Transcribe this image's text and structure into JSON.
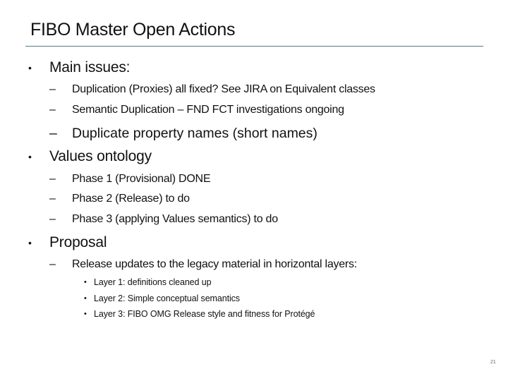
{
  "slide": {
    "title": "FIBO Master Open Actions",
    "slide_number": "21",
    "sections": [
      {
        "heading": "Main issues:",
        "items": [
          "Duplication (Proxies) all fixed? See JIRA on Equivalent classes",
          "Semantic Duplication – FND FCT investigations ongoing",
          "Duplicate property names (short names)"
        ]
      },
      {
        "heading": "Values ontology",
        "items": [
          "Phase 1 (Provisional) DONE",
          "Phase 2 (Release) to do",
          "Phase 3 (applying Values semantics) to do"
        ]
      },
      {
        "heading": "Proposal",
        "items": [
          "Release updates to the legacy material in horizontal layers:"
        ],
        "subitems": [
          "Layer 1: definitions cleaned up",
          "Layer 2: Simple conceptual semantics",
          "Layer 3: FIBO OMG Release style and fitness for Protégé"
        ]
      }
    ],
    "bullet_glyphs": {
      "level1": "•",
      "level2": "–",
      "level3": "•"
    }
  }
}
